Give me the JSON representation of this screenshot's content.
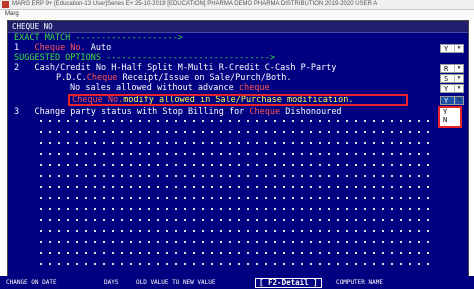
{
  "window": {
    "title": "MARG ERP 9+ [Education-13 User]Series E+ 25-10-2019 [EDUCATION] PHARMA DEMO PHARMA DISTRIBUTION 2019-2020 USER A",
    "menu_label": "Marg"
  },
  "panel": {
    "header": "CHEQUE NO"
  },
  "sections": {
    "exact_match": "EXACT MATCH",
    "exact_arrow": "-------------------->",
    "suggested": "SUGGESTED OPTIONS",
    "suggested_arrow": "-------------------------------->"
  },
  "options": [
    {
      "num": "1",
      "label_a": "Cheque No.",
      "label_b": " Auto",
      "value": "Y"
    },
    {
      "num": "2",
      "label_a": "Cash/Credit No H-Half Split M-Multi R-Credit C-Cash P-Party",
      "label_b": "",
      "value": "R"
    },
    {
      "num": "",
      "label_a": "P.D.C.",
      "label_b": "Cheque",
      "label_c": " Receipt/Issue on Sale/Purch/Both.",
      "value": "S"
    },
    {
      "num": "",
      "label_a": "No sales allowed without advance ",
      "label_b": "cheque",
      "value": "Y"
    },
    {
      "num": "",
      "label_a": "Cheque No.",
      "label_b": "modify allowed in Sale/Purchase modification.",
      "value": "Y"
    },
    {
      "num": "3",
      "label_a": "Change party status with Stop Billing for ",
      "label_b": "Cheque",
      "label_c": " Dishonoured",
      "value": "N"
    }
  ],
  "dropdown": {
    "options": [
      "Y",
      "N"
    ]
  },
  "footer": {
    "change_on_date": "CHANGE ON DATE",
    "days": "DAYS",
    "old_new": "OLD VALUE TO NEW VALUE",
    "f2": "[ F2-Detail ]",
    "computer_name": "COMPUTER NAME"
  }
}
